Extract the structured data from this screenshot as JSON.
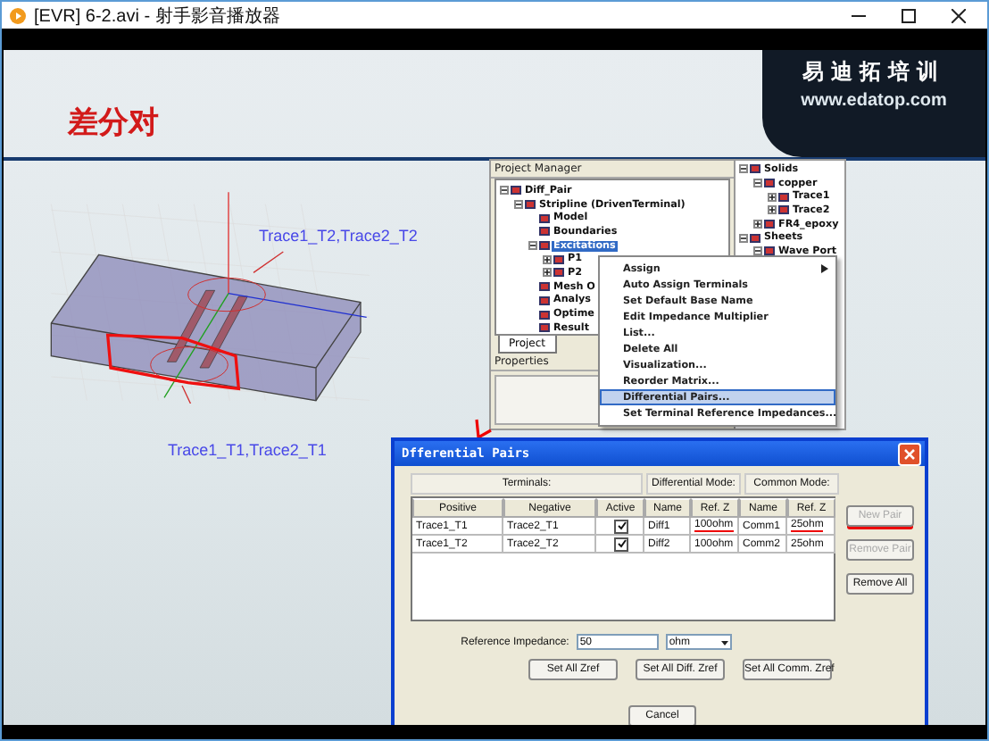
{
  "window": {
    "title": "[EVR] 6-2.avi - 射手影音播放器"
  },
  "slide": {
    "title": "差分对",
    "logo": {
      "name": "易迪拓培训",
      "url": "www.edatop.com"
    },
    "model_labels": [
      "Trace1_T2,Trace2_T2",
      "Trace1_T1,Trace2_T1"
    ]
  },
  "project_manager": {
    "title": "Project Manager",
    "tab": "Project",
    "properties_title": "Properties",
    "tree": [
      {
        "label": "Diff_Pair",
        "expanded": true,
        "selected": false,
        "children": [
          {
            "label": "Stripline (DrivenTerminal)",
            "expanded": true,
            "selected": false,
            "children": [
              {
                "label": "Model",
                "selected": false
              },
              {
                "label": "Boundaries",
                "selected": false
              },
              {
                "label": "Excitations",
                "expanded": true,
                "selected": true,
                "children": [
                  {
                    "label": "P1",
                    "expanded": false,
                    "selected": false
                  },
                  {
                    "label": "P2",
                    "expanded": false,
                    "selected": false
                  }
                ]
              },
              {
                "label": "Mesh O",
                "selected": false
              },
              {
                "label": "Analys",
                "selected": false
              },
              {
                "label": "Optime",
                "selected": false
              },
              {
                "label": "Result",
                "selected": false
              }
            ]
          }
        ]
      }
    ],
    "model_tree": [
      {
        "label": "Solids",
        "expanded": true,
        "children": [
          {
            "label": "copper",
            "expanded": true,
            "children": [
              {
                "label": "Trace1",
                "expanded": false
              },
              {
                "label": "Trace2",
                "expanded": false
              }
            ]
          },
          {
            "label": "FR4_epoxy",
            "expanded": false
          }
        ]
      },
      {
        "label": "Sheets",
        "expanded": true,
        "children": [
          {
            "label": "Wave Port",
            "expanded": true
          }
        ]
      }
    ]
  },
  "context_menu": [
    {
      "label": "Assign",
      "submenu": true,
      "selected": false
    },
    {
      "label": "Auto Assign Terminals",
      "submenu": false,
      "selected": false
    },
    {
      "label": "Set Default Base Name",
      "submenu": false,
      "selected": false
    },
    {
      "label": "Edit Impedance Multiplier",
      "submenu": false,
      "selected": false
    },
    {
      "label": "List...",
      "submenu": false,
      "selected": false
    },
    {
      "label": "Delete All",
      "submenu": false,
      "selected": false
    },
    {
      "label": "Visualization...",
      "submenu": false,
      "selected": false
    },
    {
      "label": "Reorder Matrix...",
      "submenu": false,
      "selected": false
    },
    {
      "label": "Differential Pairs...",
      "submenu": false,
      "selected": true
    },
    {
      "label": "Set Terminal Reference Impedances...",
      "submenu": false,
      "selected": false
    }
  ],
  "dialog": {
    "title": "Dfferential Pairs",
    "groups": [
      "Terminals:",
      "Differential Mode:",
      "Common Mode:"
    ],
    "columns": [
      "Positive",
      "Negative",
      "Active",
      "Name",
      "Ref. Z",
      "Name",
      "Ref. Z"
    ],
    "rows": [
      {
        "positive": "Trace1_T1",
        "negative": "Trace2_T1",
        "active": true,
        "diff_name": "Diff1",
        "diff_z": "100ohm",
        "comm_name": "Comm1",
        "comm_z": "25ohm"
      },
      {
        "positive": "Trace1_T2",
        "negative": "Trace2_T2",
        "active": true,
        "diff_name": "Diff2",
        "diff_z": "100ohm",
        "comm_name": "Comm2",
        "comm_z": "25ohm"
      }
    ],
    "side_buttons": [
      {
        "label": "New Pair",
        "disabled": true
      },
      {
        "label": "Remove Pair",
        "disabled": true
      },
      {
        "label": "Remove All",
        "disabled": false
      }
    ],
    "reference_label": "Reference Impedance:",
    "reference_value": "50",
    "unit": "ohm",
    "set_buttons": [
      "Set All Zref",
      "Set All Diff. Zref",
      "Set All Comm. Zref"
    ],
    "cancel": "Cancel"
  }
}
